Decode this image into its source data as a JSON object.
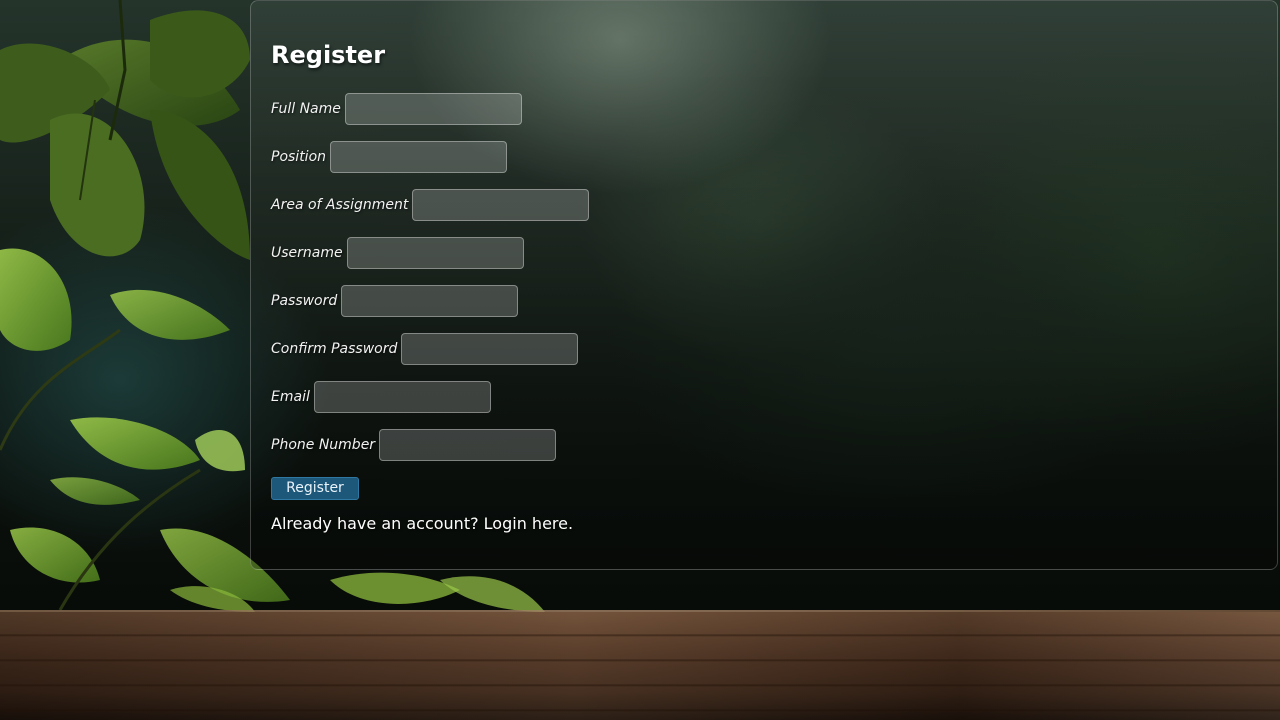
{
  "form": {
    "title": "Register",
    "fields": [
      {
        "id": "full_name",
        "label": "Full Name",
        "value": "",
        "placeholder": ""
      },
      {
        "id": "position",
        "label": "Position",
        "value": "",
        "placeholder": ""
      },
      {
        "id": "area_of_assignment",
        "label": "Area of Assignment",
        "value": "",
        "placeholder": ""
      },
      {
        "id": "username",
        "label": "Username",
        "value": "",
        "placeholder": ""
      },
      {
        "id": "password",
        "label": "Password",
        "value": "",
        "placeholder": ""
      },
      {
        "id": "confirm_password",
        "label": "Confirm Password",
        "value": "",
        "placeholder": ""
      },
      {
        "id": "email",
        "label": "Email",
        "value": "",
        "placeholder": ""
      },
      {
        "id": "phone_number",
        "label": "Phone Number",
        "value": "",
        "placeholder": ""
      }
    ],
    "submit_label": "Register",
    "login_prompt": "Already have an account? Login here."
  },
  "colors": {
    "button_bg": "#1d5779",
    "text": "#ffffff"
  }
}
